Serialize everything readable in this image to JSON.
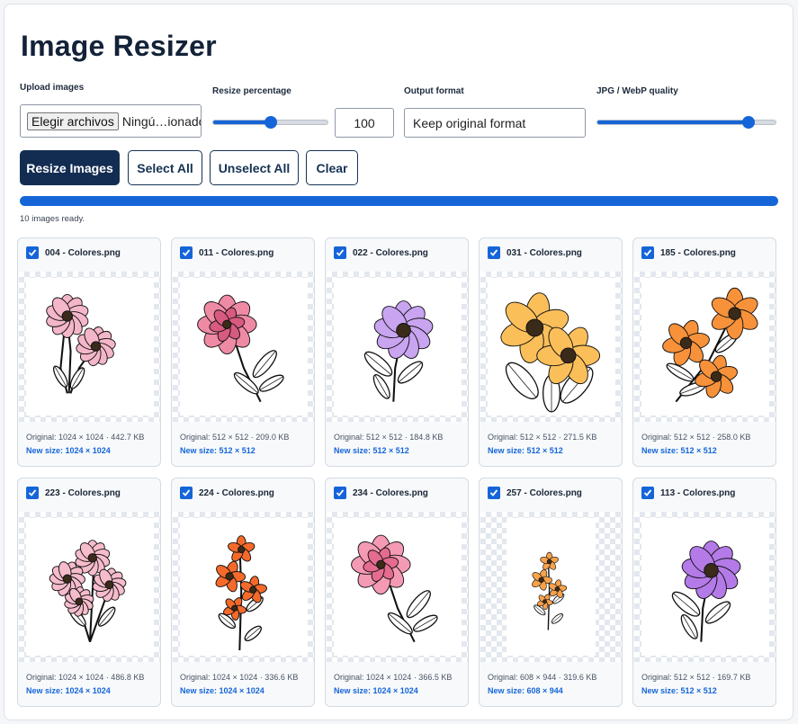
{
  "title": "Image Resizer",
  "controls": {
    "upload_label": "Upload images",
    "file_button": "Elegir archivos",
    "file_status": "Ningú…ionado",
    "resize_label": "Resize percentage",
    "resize_value": "100",
    "resize_fraction": 0.5,
    "format_label": "Output format",
    "format_value": "Keep original format",
    "quality_label": "JPG / WebP quality",
    "quality_fraction": 0.85
  },
  "buttons": {
    "resize": "Resize Images",
    "select_all": "Select All",
    "unselect_all": "Unselect All",
    "clear": "Clear"
  },
  "progress_fraction": 1.0,
  "status": "10 images ready.",
  "accent": "#1565d8",
  "images": [
    {
      "name": "004 - Colores.png",
      "original": "Original: 1024 × 1024 · 442.7 KB",
      "new_size": "New size: 1024 × 1024",
      "colors": [
        "#f4b6c9",
        "#e88aa8"
      ],
      "kind": "carnation",
      "aspect": 1.0
    },
    {
      "name": "011 - Colores.png",
      "original": "Original: 512 × 512 · 209.0 KB",
      "new_size": "New size: 512 × 512",
      "colors": [
        "#ef8aa5",
        "#d85a80"
      ],
      "kind": "peony",
      "aspect": 1.0
    },
    {
      "name": "022 - Colores.png",
      "original": "Original: 512 × 512 · 184.8 KB",
      "new_size": "New size: 512 × 512",
      "colors": [
        "#c9a4f0",
        "#a57be0"
      ],
      "kind": "daisy",
      "aspect": 1.0
    },
    {
      "name": "031 - Colores.png",
      "original": "Original: 512 × 512 · 271.5 KB",
      "new_size": "New size: 512 × 512",
      "colors": [
        "#fbbf5a",
        "#f59a2c"
      ],
      "kind": "big",
      "aspect": 1.0
    },
    {
      "name": "185 - Colores.png",
      "original": "Original: 512 × 512 · 258.0 KB",
      "new_size": "New size: 512 × 512",
      "colors": [
        "#f7913a",
        "#e36b12"
      ],
      "kind": "lily",
      "aspect": 1.0
    },
    {
      "name": "223 - Colores.png",
      "original": "Original: 1024 × 1024 · 486.8 KB",
      "new_size": "New size: 1024 × 1024",
      "colors": [
        "#f6bccc",
        "#ea8fab"
      ],
      "kind": "bouquet",
      "aspect": 1.0
    },
    {
      "name": "224 - Colores.png",
      "original": "Original: 1024 × 1024 · 336.6 KB",
      "new_size": "New size: 1024 × 1024",
      "colors": [
        "#f56a2a",
        "#d9480f"
      ],
      "kind": "branch",
      "aspect": 1.0
    },
    {
      "name": "234 - Colores.png",
      "original": "Original: 1024 × 1024 · 366.5 KB",
      "new_size": "New size: 1024 × 1024",
      "colors": [
        "#f59ab4",
        "#e56b90"
      ],
      "kind": "peony",
      "aspect": 1.0
    },
    {
      "name": "257 - Colores.png",
      "original": "Original: 608 × 944 · 319.6 KB",
      "new_size": "New size: 608 × 944",
      "colors": [
        "#f7a24a",
        "#e67e22"
      ],
      "kind": "branch",
      "aspect": 0.644
    },
    {
      "name": "113 - Colores.png",
      "original": "Original: 512 × 512 · 169.7 KB",
      "new_size": "New size: 512 × 512",
      "colors": [
        "#b47ae8",
        "#8c4fd6"
      ],
      "kind": "daisy",
      "aspect": 1.0
    }
  ]
}
